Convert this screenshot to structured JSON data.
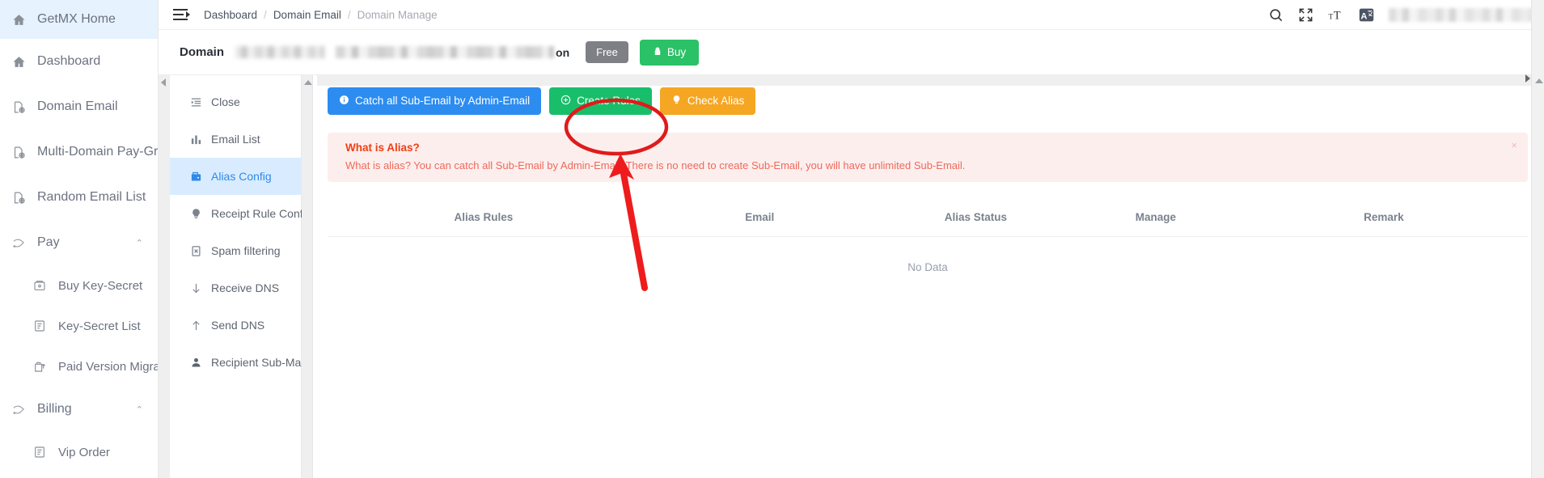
{
  "sidebar": {
    "items": [
      {
        "label": "GetMX Home",
        "icon": "home-icon",
        "active": true,
        "sub": false,
        "caret": ""
      },
      {
        "label": "Dashboard",
        "icon": "home-icon",
        "active": false,
        "sub": false,
        "caret": ""
      },
      {
        "label": "Domain Email",
        "icon": "domain-icon",
        "active": false,
        "sub": false,
        "caret": ""
      },
      {
        "label": "Multi-Domain Pay-Group",
        "icon": "domain-icon",
        "active": false,
        "sub": false,
        "caret": ""
      },
      {
        "label": "Random Email List",
        "icon": "domain-icon",
        "active": false,
        "sub": false,
        "caret": ""
      },
      {
        "label": "Pay",
        "icon": "pay-icon",
        "active": false,
        "sub": false,
        "caret": "⌃"
      },
      {
        "label": "Buy Key-Secret",
        "icon": "wallet-icon",
        "active": false,
        "sub": true,
        "caret": ""
      },
      {
        "label": "Key-Secret List",
        "icon": "list-icon",
        "active": false,
        "sub": true,
        "caret": ""
      },
      {
        "label": "Paid Version Migration",
        "icon": "upgrade-icon",
        "active": false,
        "sub": true,
        "caret": ""
      },
      {
        "label": "Billing",
        "icon": "pay-icon",
        "active": false,
        "sub": false,
        "caret": "⌃"
      },
      {
        "label": "Vip Order",
        "icon": "list-icon",
        "active": false,
        "sub": true,
        "caret": ""
      }
    ]
  },
  "topbar": {
    "menu_toggle": "collapse-menu-icon",
    "breadcrumbs": [
      {
        "label": "Dashboard",
        "current": false
      },
      {
        "label": "Domain Email",
        "current": false
      },
      {
        "label": "Domain Manage",
        "current": true
      }
    ],
    "separator": "/",
    "icons": [
      "search-icon",
      "fullscreen-icon",
      "font-size-icon",
      "translate-icon"
    ],
    "translate_glyph": "A"
  },
  "domain_bar": {
    "label": "Domain",
    "name_suffix": "on",
    "plan_badge": "Free",
    "buy_button": "Buy",
    "buy_icon": "lock-icon"
  },
  "submenu": {
    "items": [
      {
        "label": "Close",
        "icon": "collapse-icon",
        "active": false
      },
      {
        "label": "Email List",
        "icon": "chart-bar-icon",
        "active": false
      },
      {
        "label": "Alias Config",
        "icon": "wallet-icon",
        "active": true
      },
      {
        "label": "Receipt Rule Config",
        "icon": "bulb-icon",
        "active": false
      },
      {
        "label": "Spam filtering",
        "icon": "spam-icon",
        "active": false
      },
      {
        "label": "Receive DNS",
        "icon": "arrow-down-icon",
        "active": false
      },
      {
        "label": "Send DNS",
        "icon": "arrow-up-icon",
        "active": false
      },
      {
        "label": "Recipient Sub-Mail",
        "icon": "user-icon",
        "active": false
      }
    ]
  },
  "main": {
    "buttons": [
      {
        "label": "Catch all Sub-Email by Admin-Email",
        "style": "blue",
        "icon": "info-circle-icon"
      },
      {
        "label": "Create Rules",
        "style": "green",
        "icon": "plus-circle-icon"
      },
      {
        "label": "Check Alias",
        "style": "amber",
        "icon": "bulb-icon"
      }
    ],
    "alert": {
      "title": "What is Alias?",
      "text": "What is alias? You can catch all Sub-Email by Admin-Email. There is no need to create Sub-Email, you will have unlimited Sub-Email.",
      "close": "×"
    },
    "table": {
      "columns": [
        "Alias Rules",
        "Email",
        "Alias Status",
        "Manage",
        "Remark"
      ],
      "empty_text": "No Data",
      "rows": []
    }
  },
  "annotation": {
    "type": "red-ellipse-and-arrow",
    "target": "Create Rules",
    "color": "#e01b1b"
  },
  "colors": {
    "accent_blue": "#2d8cf0",
    "green": "#19be6b",
    "amber": "#f5a623",
    "alert_bg": "#fdeeee",
    "alert_title": "#ed4014",
    "active_nav_bg": "#d9ecff"
  }
}
